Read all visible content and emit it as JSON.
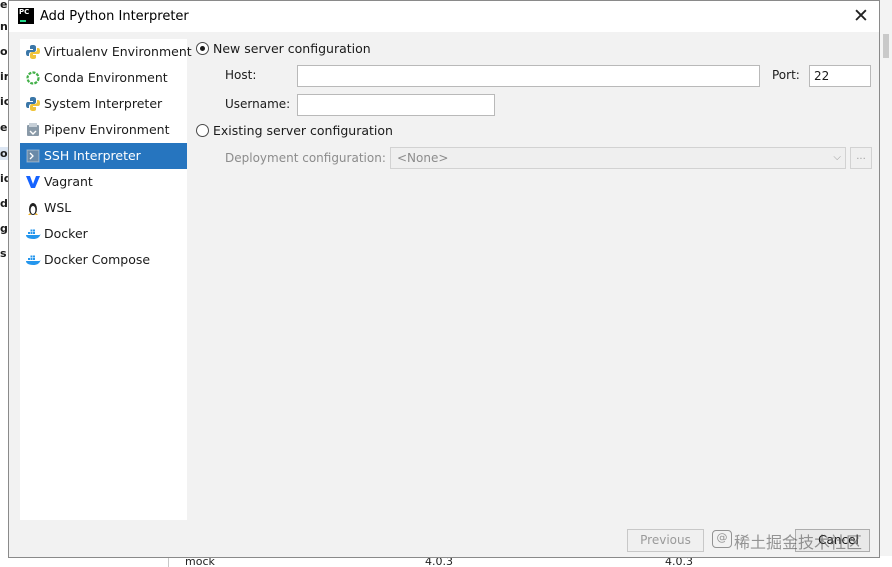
{
  "background": {
    "left_fragments": [
      "ea",
      "na",
      "or",
      "ir",
      "ic",
      "ec",
      "o",
      "id",
      "d,",
      "gu",
      "s"
    ],
    "table_row": {
      "name": "mock",
      "version": "4.0.3",
      "latest": "4.0.3"
    }
  },
  "dialog": {
    "title": "Add Python Interpreter",
    "app_icon_text": "PC",
    "close_glyph": "✕"
  },
  "sidebar": {
    "items": [
      {
        "label": "Virtualenv Environment",
        "icon": "python-icon"
      },
      {
        "label": "Conda Environment",
        "icon": "conda-icon"
      },
      {
        "label": "System Interpreter",
        "icon": "python-icon"
      },
      {
        "label": "Pipenv Environment",
        "icon": "pipenv-icon"
      },
      {
        "label": "SSH Interpreter",
        "icon": "ssh-terminal-icon",
        "selected": true
      },
      {
        "label": "Vagrant",
        "icon": "vagrant-icon"
      },
      {
        "label": "WSL",
        "icon": "linux-tux-icon"
      },
      {
        "label": "Docker",
        "icon": "docker-icon"
      },
      {
        "label": "Docker Compose",
        "icon": "docker-icon"
      }
    ]
  },
  "form": {
    "new_server_label": "New server configuration",
    "new_server_selected": true,
    "host_label": "Host:",
    "host_value": "",
    "port_label": "Port:",
    "port_value": "22",
    "username_label": "Username:",
    "username_value": "",
    "existing_server_label": "Existing server configuration",
    "existing_server_selected": false,
    "deployment_label": "Deployment configuration:",
    "deployment_value": "<None>",
    "browse_label": "..."
  },
  "footer": {
    "previous_label": "Previous",
    "cancel_label": "Cancel",
    "watermark": "稀土掘金技术社区",
    "watermark_at": "@"
  },
  "colors": {
    "selection": "#2675bf",
    "dialog_bg": "#f2f2f2",
    "sidebar_bg": "#ffffff"
  }
}
